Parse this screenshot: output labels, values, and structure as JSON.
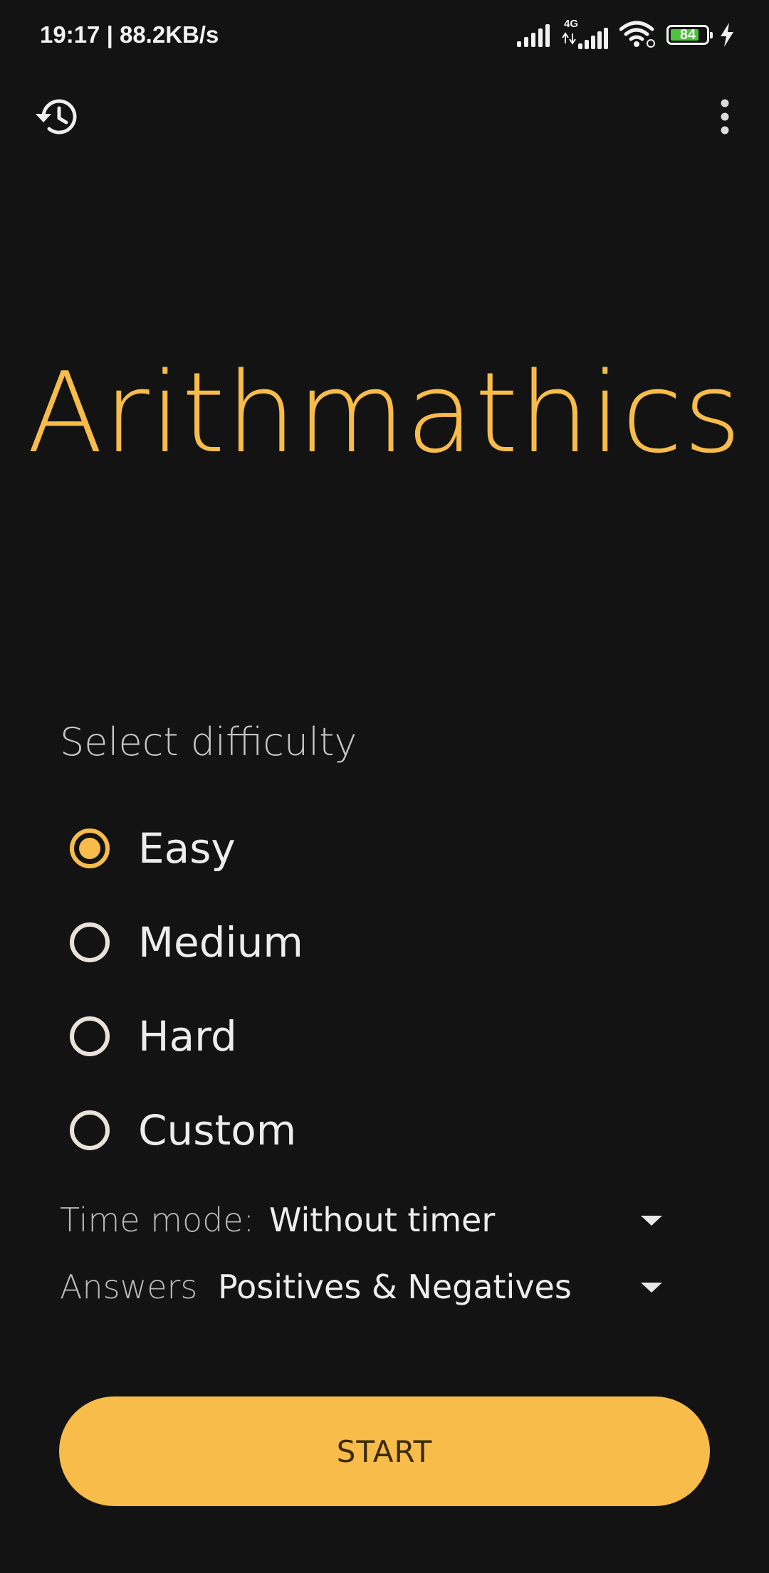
{
  "status_bar": {
    "time_speed": "19:17 | 88.2KB/s",
    "network_label": "4G",
    "battery_level": "84",
    "battery_fraction": 0.84,
    "icons": [
      "signal-icon",
      "signal-4g-icon",
      "wifi-icon",
      "battery-icon",
      "charging-bolt-icon"
    ]
  },
  "app_bar": {
    "history_icon": "history-icon",
    "menu_icon": "more-vert-icon"
  },
  "title": "Arithmathics",
  "difficulty": {
    "label": "Select difficulty",
    "selected": "Easy",
    "options": [
      {
        "label": "Easy",
        "checked": true
      },
      {
        "label": "Medium",
        "checked": false
      },
      {
        "label": "Hard",
        "checked": false
      },
      {
        "label": "Custom",
        "checked": false
      }
    ]
  },
  "time_mode": {
    "label": "Time mode:",
    "value": "Without timer"
  },
  "answers": {
    "label": "Answers",
    "value": "Positives & Negatives"
  },
  "start_button": "START",
  "colors": {
    "background": "#131313",
    "accent": "#f7bc4a",
    "text": "#ececec",
    "muted_text": "#c5c5c5"
  }
}
